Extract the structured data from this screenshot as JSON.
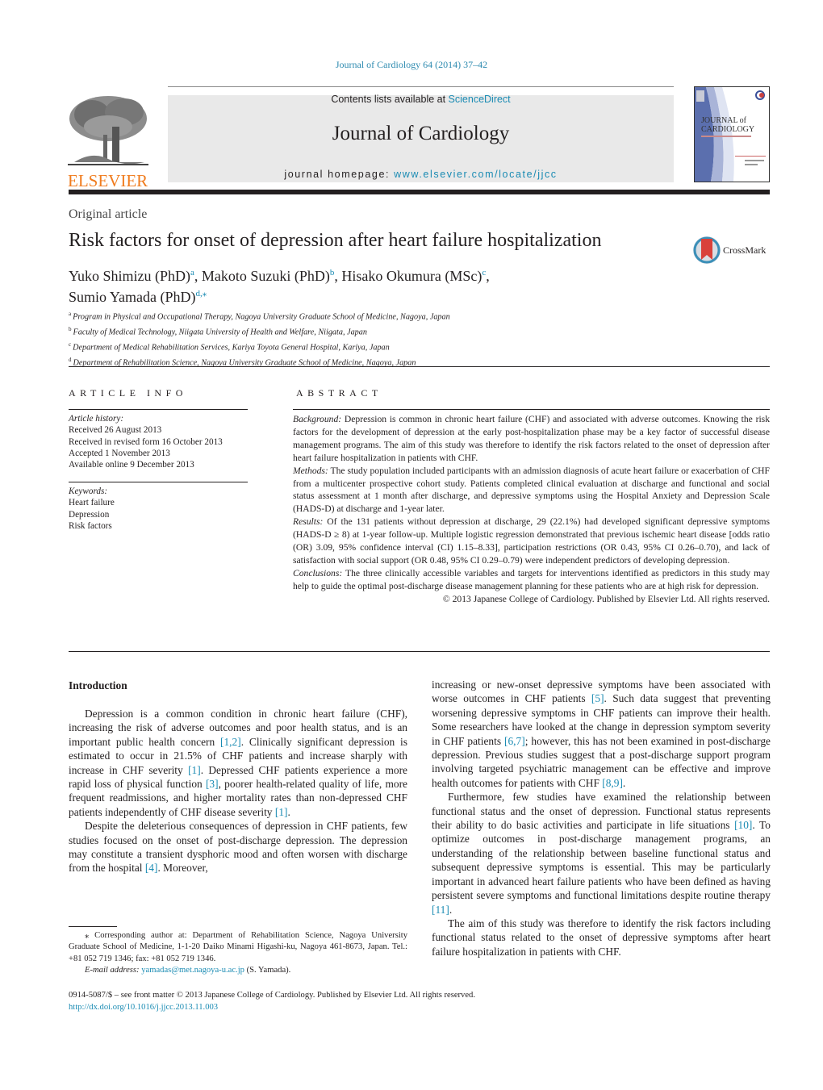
{
  "citation": "Journal of Cardiology 64 (2014) 37–42",
  "masthead": {
    "contents_prefix": "Contents lists available at ",
    "contents_link": "ScienceDirect",
    "journal_name": "Journal of Cardiology",
    "homepage_prefix": "journal homepage: ",
    "homepage_link": "www.elsevier.com/locate/jjcc",
    "publisher_logo": "ELSEVIER",
    "cover": {
      "title_line1": "JOURNAL of",
      "title_line2": "CARDIOLOGY"
    }
  },
  "article": {
    "type": "Original article",
    "title": "Risk factors for onset of depression after heart failure hospitalization",
    "crossmark_label": "CrossMark",
    "authors": [
      {
        "name": "Yuko Shimizu (PhD)",
        "sup": "a",
        "sep": ", "
      },
      {
        "name": "Makoto Suzuki (PhD)",
        "sup": "b",
        "sep": ", "
      },
      {
        "name": "Hisako Okumura (MSc)",
        "sup": "c",
        "sep": ","
      },
      {
        "name": "Sumio Yamada (PhD)",
        "sup": "d,⁎",
        "sep": ""
      }
    ],
    "affiliations": [
      {
        "key": "a",
        "text": "Program in Physical and Occupational Therapy, Nagoya University Graduate School of Medicine, Nagoya, Japan"
      },
      {
        "key": "b",
        "text": "Faculty of Medical Technology, Niigata University of Health and Welfare, Niigata, Japan"
      },
      {
        "key": "c",
        "text": "Department of Medical Rehabilitation Services, Kariya Toyota General Hospital, Kariya, Japan"
      },
      {
        "key": "d",
        "text": "Department of Rehabilitation Science, Nagoya University Graduate School of Medicine, Nagoya, Japan"
      }
    ]
  },
  "article_info": {
    "heading": "ARTICLE INFO",
    "history_label": "Article history:",
    "history": [
      "Received 26 August 2013",
      "Received in revised form 16 October 2013",
      "Accepted 1 November 2013",
      "Available online 9 December 2013"
    ],
    "keywords_label": "Keywords:",
    "keywords": [
      "Heart failure",
      "Depression",
      "Risk factors"
    ]
  },
  "abstract": {
    "heading": "ABSTRACT",
    "sections": [
      {
        "label": "Background:",
        "text": " Depression is common in chronic heart failure (CHF) and associated with adverse outcomes. Knowing the risk factors for the development of depression at the early post-hospitalization phase may be a key factor of successful disease management programs. The aim of this study was therefore to identify the risk factors related to the onset of depression after heart failure hospitalization in patients with CHF."
      },
      {
        "label": "Methods:",
        "text": " The study population included participants with an admission diagnosis of acute heart failure or exacerbation of CHF from a multicenter prospective cohort study. Patients completed clinical evaluation at discharge and functional and social status assessment at 1 month after discharge, and depressive symptoms using the Hospital Anxiety and Depression Scale (HADS-D) at discharge and 1-year later."
      },
      {
        "label": "Results:",
        "text": " Of the 131 patients without depression at discharge, 29 (22.1%) had developed significant depressive symptoms (HADS-D ≥ 8) at 1-year follow-up. Multiple logistic regression demonstrated that previous ischemic heart disease [odds ratio (OR) 3.09, 95% confidence interval (CI) 1.15–8.33], participation restrictions (OR 0.43, 95% CI 0.26–0.70), and lack of satisfaction with social support (OR 0.48, 95% CI 0.29–0.79) were independent predictors of developing depression."
      },
      {
        "label": "Conclusions:",
        "text": " The three clinically accessible variables and targets for interventions identified as predictors in this study may help to guide the optimal post-discharge disease management planning for these patients who are at high risk for depression."
      }
    ],
    "copyright": "© 2013 Japanese College of Cardiology. Published by Elsevier Ltd. All rights reserved."
  },
  "body": {
    "intro_heading": "Introduction",
    "left_paragraphs": [
      [
        {
          "t": "Depression is a common condition in chronic heart failure (CHF), increasing the risk of adverse outcomes and poor health status, and is an important public health concern "
        },
        {
          "ref": "[1,2]"
        },
        {
          "t": ". Clinically significant depression is estimated to occur in 21.5% of CHF patients and increase sharply with increase in CHF severity "
        },
        {
          "ref": "[1]"
        },
        {
          "t": ". Depressed CHF patients experience a more rapid loss of physical function "
        },
        {
          "ref": "[3]"
        },
        {
          "t": ", poorer health-related quality of life, more frequent readmissions, and higher mortality rates than non-depressed CHF patients independently of CHF disease severity "
        },
        {
          "ref": "[1]"
        },
        {
          "t": "."
        }
      ],
      [
        {
          "t": "Despite the deleterious consequences of depression in CHF patients, few studies focused on the onset of post-discharge depression. The depression may constitute a transient dysphoric mood and often worsen with discharge from the hospital "
        },
        {
          "ref": "[4]"
        },
        {
          "t": ". Moreover,"
        }
      ]
    ],
    "right_paragraphs": [
      [
        {
          "t": "increasing or new-onset depressive symptoms have been associated with worse outcomes in CHF patients "
        },
        {
          "ref": "[5]"
        },
        {
          "t": ". Such data suggest that preventing worsening depressive symptoms in CHF patients can improve their health. Some researchers have looked at the change in depression symptom severity in CHF patients "
        },
        {
          "ref": "[6,7]"
        },
        {
          "t": "; however, this has not been examined in post-discharge depression. Previous studies suggest that a post-discharge support program involving targeted psychiatric management can be effective and improve health outcomes for patients with CHF "
        },
        {
          "ref": "[8,9]"
        },
        {
          "t": "."
        }
      ],
      [
        {
          "t": "Furthermore, few studies have examined the relationship between functional status and the onset of depression. Functional status represents their ability to do basic activities and participate in life situations "
        },
        {
          "ref": "[10]"
        },
        {
          "t": ". To optimize outcomes in post-discharge management programs, an understanding of the relationship between baseline functional status and subsequent depressive symptoms is essential. This may be particularly important in advanced heart failure patients who have been defined as having persistent severe symptoms and functional limitations despite routine therapy "
        },
        {
          "ref": "[11]"
        },
        {
          "t": "."
        }
      ],
      [
        {
          "t": "The aim of this study was therefore to identify the risk factors including functional status related to the onset of depressive symptoms after heart failure hospitalization in patients with CHF."
        }
      ]
    ]
  },
  "footnote": {
    "corresponding": "⁎ Corresponding author at: Department of Rehabilitation Science, Nagoya University Graduate School of Medicine, 1-1-20 Daiko Minami Higashi-ku, Nagoya 461-8673, Japan. Tel.: +81 052 719 1346; fax: +81 052 719 1346.",
    "email_label": "E-mail address:",
    "email": "yamadas@met.nagoya-u.ac.jp",
    "email_suffix": " (S. Yamada)."
  },
  "front_matter": {
    "issn_line": "0914-5087/$ – see front matter © 2013 Japanese College of Cardiology. Published by Elsevier Ltd. All rights reserved.",
    "doi": "http://dx.doi.org/10.1016/j.jjcc.2013.11.003"
  },
  "colors": {
    "link": "#1a8bb3",
    "elsevier_orange": "#f07c1e",
    "masthead_bg": "#e9e9e9"
  }
}
